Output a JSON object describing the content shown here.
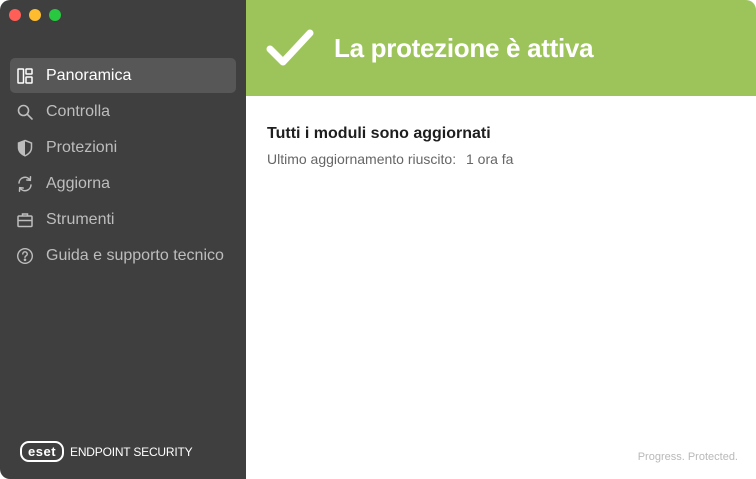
{
  "sidebar": {
    "items": [
      {
        "label": "Panoramica",
        "icon": "overview-icon",
        "active": true
      },
      {
        "label": "Controlla",
        "icon": "search-icon"
      },
      {
        "label": "Protezioni",
        "icon": "shield-icon"
      },
      {
        "label": "Aggiorna",
        "icon": "refresh-icon"
      },
      {
        "label": "Strumenti",
        "icon": "briefcase-icon"
      },
      {
        "label": "Guida e supporto tecnico",
        "icon": "help-icon"
      }
    ],
    "brand": {
      "logo_text": "eset",
      "product": "ENDPOINT SECURITY"
    }
  },
  "banner": {
    "title": "La protezione è attiva",
    "color": "#9dc45a"
  },
  "status": {
    "heading": "Tutti i moduli sono aggiornati",
    "last_update_label": "Ultimo aggiornamento riuscito:",
    "last_update_value": "1 ora fa"
  },
  "footer": {
    "tagline": "Progress. Protected."
  }
}
